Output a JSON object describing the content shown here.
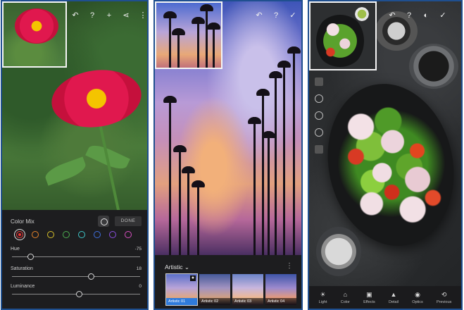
{
  "screen1": {
    "toolbar_icons": [
      "undo-icon",
      "help-icon",
      "add-icon",
      "share-icon",
      "more-icon"
    ],
    "color_mix": {
      "title": "Color Mix",
      "done_label": "DONE",
      "swatches": [
        {
          "name": "red",
          "color": "#e23b3b",
          "selected": true
        },
        {
          "name": "orange",
          "color": "#e8842a"
        },
        {
          "name": "yellow",
          "color": "#d9c12a"
        },
        {
          "name": "green",
          "color": "#4caf50"
        },
        {
          "name": "aqua",
          "color": "#3ec6c9"
        },
        {
          "name": "blue",
          "color": "#3f6fe0"
        },
        {
          "name": "purple",
          "color": "#8a4fe0"
        },
        {
          "name": "magenta",
          "color": "#d94fc2"
        }
      ],
      "sliders": [
        {
          "label": "Hue",
          "value": "-75",
          "level": 0.13
        },
        {
          "label": "Saturation",
          "value": "18",
          "level": 0.59
        },
        {
          "label": "Luminance",
          "value": "0",
          "level": 0.5
        }
      ]
    }
  },
  "screen2": {
    "toolbar_icons": [
      "undo-icon",
      "help-icon",
      "checkmark-icon"
    ],
    "preset_group": "Artistic",
    "presets": [
      "Artistic 01",
      "Artistic 02",
      "Artistic 03",
      "Artistic 04"
    ],
    "selected_preset": 0
  },
  "screen3": {
    "toolbar_icons": [
      "undo-icon",
      "help-icon",
      "compare-icon",
      "checkmark-icon"
    ],
    "tools": [
      {
        "label": "Light",
        "icon": "sun-icon"
      },
      {
        "label": "Color",
        "icon": "thermometer-icon"
      },
      {
        "label": "Effects",
        "icon": "effects-icon"
      },
      {
        "label": "Detail",
        "icon": "triangle-icon"
      },
      {
        "label": "Optics",
        "icon": "lens-icon"
      },
      {
        "label": "Previous",
        "icon": "previous-icon"
      }
    ]
  },
  "colors": {
    "accent": "#2f7bdc",
    "frame": "#1f4f8f",
    "panel": "#1d1d1f"
  }
}
